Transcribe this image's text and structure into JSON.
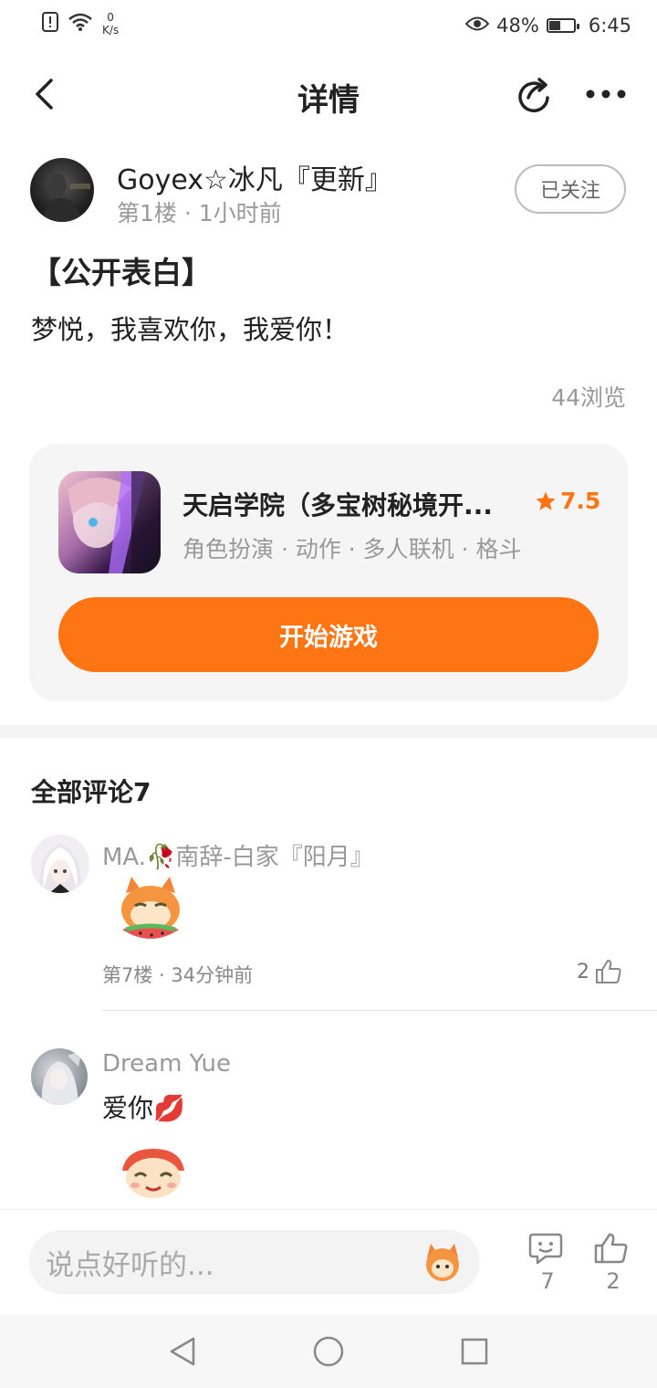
{
  "status_bar": {
    "net_speed_value": "0",
    "net_speed_unit": "K/s",
    "battery": "48%",
    "time": "6:45",
    "battery_level": 0.48
  },
  "nav": {
    "title": "详情"
  },
  "post": {
    "author": "Goyex☆冰凡『更新』",
    "floor": "第1楼",
    "time": "1小时前",
    "follow_label": "已关注",
    "title": "【公开表白】",
    "body": "梦悦，我喜欢你，我爱你！",
    "views": "44浏览"
  },
  "game": {
    "name": "天启学院（多宝树秘境开...",
    "rating": "7.5",
    "tags": "角色扮演 · 动作 · 多人联机 · 格斗",
    "play_label": "开始游戏"
  },
  "comments": {
    "header": "全部评论7",
    "items": [
      {
        "name": "MA.🥀南辞-白家『阳月』",
        "text": "",
        "floor": "第7楼",
        "time": "34分钟前",
        "likes": "2"
      },
      {
        "name": "Dream Yue",
        "text": "爱你💋",
        "floor": "",
        "time": "",
        "likes": ""
      }
    ]
  },
  "bottom_bar": {
    "input_placeholder": "说点好听的...",
    "comment_count": "7",
    "like_count": "2"
  },
  "colors": {
    "accent": "#ff7413",
    "muted": "#999999"
  }
}
